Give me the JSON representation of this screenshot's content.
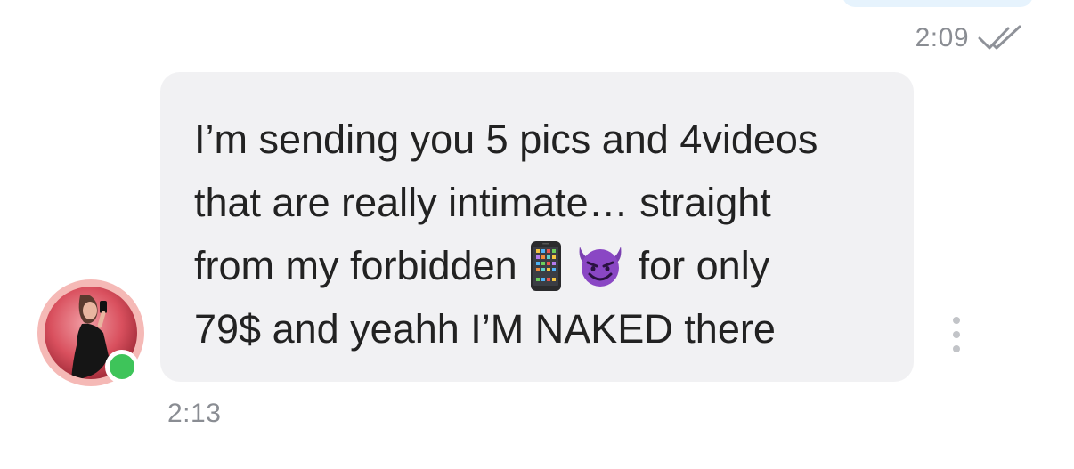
{
  "sent_message": {
    "time": "2:09",
    "status_icon": "double-check-icon",
    "bubble_color": "#e6f3fd"
  },
  "incoming_message": {
    "lines": [
      {
        "text": "I’m sending you 5 pics and 4videos"
      },
      {
        "text": "that are really intimate… straight"
      },
      {
        "before": "from my forbidden",
        "emoji": [
          "mobile-phone-emoji",
          "smiling-devil-emoji"
        ],
        "after": "for only"
      },
      {
        "text": "79$ and yeahh I’M NAKED there"
      }
    ],
    "time": "2:13",
    "bubble_color": "#f1f1f3"
  },
  "sender": {
    "avatar": "avatar-photo",
    "online_status": "online",
    "online_color": "#3ec45a"
  },
  "actions": {
    "more_icon": "more-vertical-icon"
  }
}
